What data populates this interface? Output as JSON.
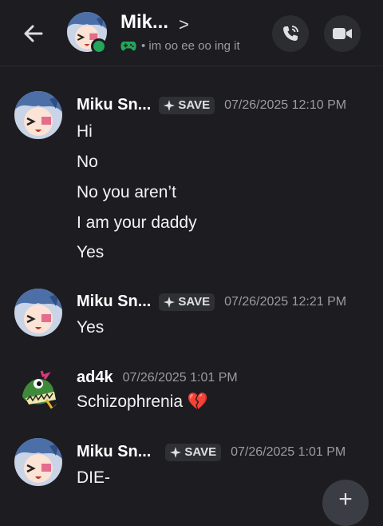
{
  "header": {
    "name": "Mik...",
    "chevron": ">",
    "status": "• im oo ee oo ing it",
    "status_icon": "gamepad-icon"
  },
  "messages": [
    {
      "username": "Miku Sn...",
      "badge": "SAVE",
      "timestamp": "07/26/2025 12:10 PM",
      "lines": [
        "Hi",
        "No",
        "No you aren’t",
        "I am your daddy",
        "Yes"
      ]
    },
    {
      "username": "Miku Sn...",
      "badge": "SAVE",
      "timestamp": "07/26/2025 12:21 PM",
      "lines": [
        "Yes"
      ]
    },
    {
      "username": "ad4k",
      "timestamp": "07/26/2025 1:01 PM",
      "lines": [
        "Schizophrenia 💔"
      ]
    },
    {
      "username": "Miku Sn...",
      "badge": "SAVE",
      "timestamp": "07/26/2025 1:01 PM",
      "lines": [
        "DIE-"
      ]
    }
  ],
  "fab": {
    "label": "+"
  },
  "colors": {
    "background": "#1c1c21",
    "online": "#23a55a",
    "game": "#23a55a",
    "broken_heart": "#e0334f"
  }
}
